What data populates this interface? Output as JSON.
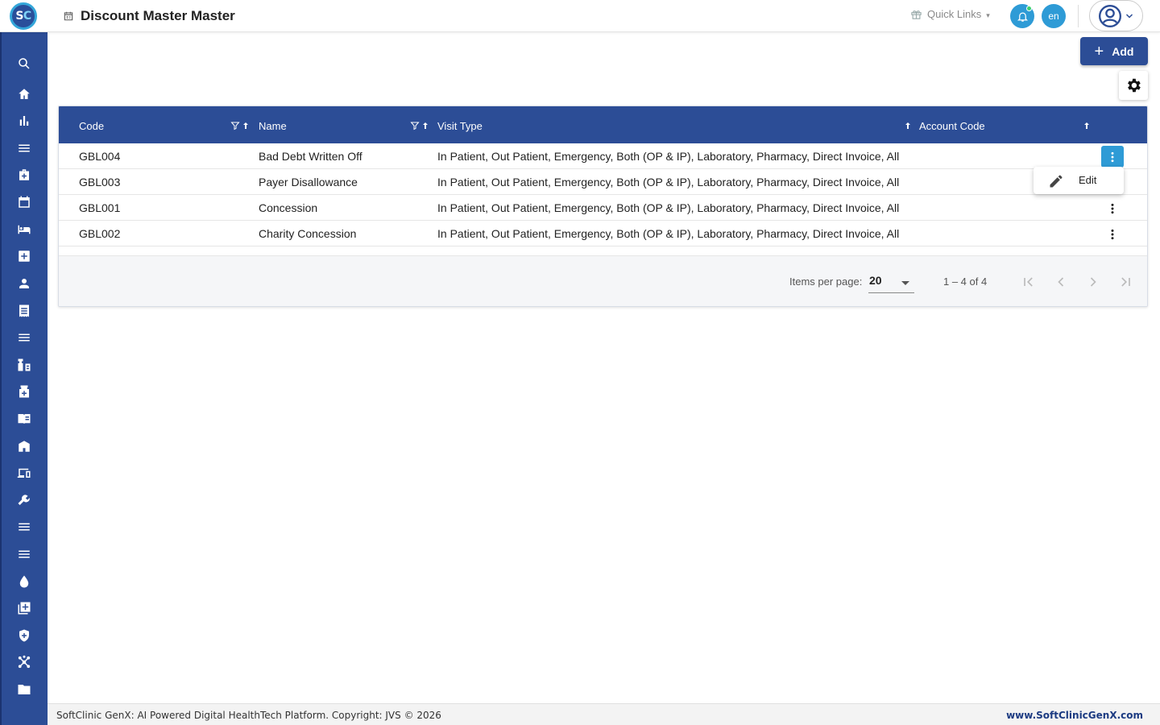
{
  "header": {
    "logo_text_s": "S",
    "logo_text_c": "C",
    "title": "Discount Master Master",
    "quick_links": "Quick Links",
    "lang": "en"
  },
  "sidebar": {
    "items": [
      {
        "icon": "search-icon"
      },
      {
        "icon": "home-icon"
      },
      {
        "icon": "bar-chart-icon"
      },
      {
        "icon": "menu-icon"
      },
      {
        "icon": "medical-bag-icon"
      },
      {
        "icon": "calendar-icon"
      },
      {
        "icon": "bed-icon"
      },
      {
        "icon": "add-box-icon"
      },
      {
        "icon": "person-icon"
      },
      {
        "icon": "receipt-icon"
      },
      {
        "icon": "list-icon"
      },
      {
        "icon": "pharmacy-icon"
      },
      {
        "icon": "medicine-icon"
      },
      {
        "icon": "book-icon"
      },
      {
        "icon": "building-icon"
      },
      {
        "icon": "devices-icon"
      },
      {
        "icon": "wrench-icon"
      },
      {
        "icon": "list-icon-2"
      },
      {
        "icon": "list-icon-3"
      },
      {
        "icon": "drop-icon"
      },
      {
        "icon": "library-add-icon"
      },
      {
        "icon": "shield-icon"
      },
      {
        "icon": "hub-icon"
      },
      {
        "icon": "folder-icon"
      }
    ]
  },
  "toolbar": {
    "add_label": "Add"
  },
  "table": {
    "columns": [
      "Code",
      "Name",
      "Visit Type",
      "Account Code"
    ],
    "rows": [
      {
        "code": "GBL004",
        "name": "Bad Debt Written Off",
        "visit_type": "In Patient, Out Patient, Emergency, Both (OP & IP), Laboratory, Pharmacy, Direct Invoice, All",
        "account_code": ""
      },
      {
        "code": "GBL003",
        "name": "Payer Disallowance",
        "visit_type": "In Patient, Out Patient, Emergency, Both (OP & IP), Laboratory, Pharmacy, Direct Invoice, All",
        "account_code": ""
      },
      {
        "code": "GBL001",
        "name": "Concession",
        "visit_type": "In Patient, Out Patient, Emergency, Both (OP & IP), Laboratory, Pharmacy, Direct Invoice, All",
        "account_code": ""
      },
      {
        "code": "GBL002",
        "name": "Charity Concession",
        "visit_type": "In Patient, Out Patient, Emergency, Both (OP & IP), Laboratory, Pharmacy, Direct Invoice, All",
        "account_code": ""
      }
    ]
  },
  "row_menu": {
    "edit_label": "Edit"
  },
  "paginator": {
    "items_per_page_label": "Items per page:",
    "items_per_page_value": "20",
    "range_label": "1 – 4 of 4"
  },
  "footer": {
    "copyright": "SoftClinic GenX: AI Powered Digital HealthTech Platform. Copyright: JVS © 2026",
    "website": "www.SoftClinicGenX.com"
  },
  "colors": {
    "primary": "#2c4d96",
    "accent": "#2e9bd6"
  }
}
